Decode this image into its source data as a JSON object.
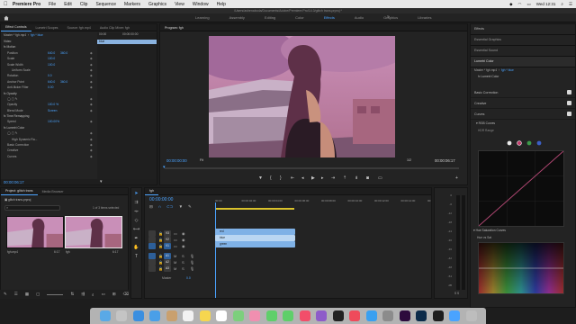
{
  "menubar": {
    "app": "Premiere Pro",
    "items": [
      "File",
      "Edit",
      "Clip",
      "Sequence",
      "Markers",
      "Graphics",
      "View",
      "Window",
      "Help"
    ],
    "clock": "Wed 12:31"
  },
  "window": {
    "title": "/Users/ashenaboda/Documents/Adobe/Premiere Pro/14.0/glitch trans.prproj *"
  },
  "workspaces": {
    "tabs": [
      "Learning",
      "Assembly",
      "Editing",
      "Color",
      "Effects",
      "Audio",
      "Graphics",
      "Libraries"
    ],
    "active": "Effects",
    "more": "»"
  },
  "source_panel": {
    "tabs": [
      "Effect Controls",
      "Lumetri Scopes",
      "Source: fgh.mp4",
      "Audio Clip Mixer: fgh"
    ],
    "master": "Master * fgh.mp4",
    "clip": "fgh * blue",
    "tc_start": "00:00",
    "tc_end": "00:00:00:00",
    "clip_label": "blue",
    "rows": [
      {
        "label": "Video",
        "indent": 0,
        "hdr": true
      },
      {
        "label": "fx  Motion",
        "indent": 0,
        "hdr": true
      },
      {
        "label": "Position",
        "indent": 1,
        "v": "640.0",
        "v2": "360.0"
      },
      {
        "label": "Scale",
        "indent": 1,
        "v": "100.0"
      },
      {
        "label": "Scale Width",
        "indent": 1,
        "v": "100.0"
      },
      {
        "label": "Uniform Scale",
        "indent": 2,
        "v": ""
      },
      {
        "label": "Rotation",
        "indent": 1,
        "v": "0.0"
      },
      {
        "label": "Anchor Point",
        "indent": 1,
        "v": "640.0",
        "v2": "360.0"
      },
      {
        "label": "Anti-flicker Filter",
        "indent": 1,
        "v": "0.00"
      },
      {
        "label": "fx  Opacity",
        "indent": 0,
        "hdr": true
      },
      {
        "label": "◯ ▢ ✎",
        "indent": 1,
        "v": ""
      },
      {
        "label": "Opacity",
        "indent": 1,
        "v": "100.0 %"
      },
      {
        "label": "Blend Mode",
        "indent": 1,
        "v": "Screen"
      },
      {
        "label": "fx  Time Remapping",
        "indent": 0,
        "hdr": true
      },
      {
        "label": "Speed",
        "indent": 1,
        "v": "100.00%"
      },
      {
        "label": "fx  Lumetri Color",
        "indent": 0,
        "hdr": true
      },
      {
        "label": "◯ ▢ ✎",
        "indent": 1,
        "v": ""
      },
      {
        "label": "High Dynamic Ra...",
        "indent": 2,
        "v": ""
      },
      {
        "label": "Basic Correction",
        "indent": 1,
        "v": ""
      },
      {
        "label": "Creative",
        "indent": 1,
        "v": ""
      },
      {
        "label": "Curves",
        "indent": 1,
        "v": ""
      }
    ],
    "bottom_tc": "00:00:06:17"
  },
  "program": {
    "tab": "Program: fgh",
    "tc_current": "00:00:00:00",
    "fit": "Fit",
    "quality": "1/2",
    "tc_duration": "00:00:06:17"
  },
  "effects_panel": {
    "tabs": [
      "Effects",
      "Essential Graphics",
      "Essential Sound",
      "Lumetri Color",
      "Libraries",
      "Markers",
      "History",
      "Info"
    ],
    "master": "Master * fgh.mp4",
    "clip": "fgh * blue",
    "fx_name": "Lumetri Color",
    "sections": [
      "Basic Correction",
      "Creative",
      "Curves"
    ],
    "rgb_curves": "RGB Curves",
    "hsl_range": "HDR Range",
    "hsl_curves": "Hue Saturation Curves",
    "hue_vs_sat": "Hue vs Sat"
  },
  "project": {
    "tabs": [
      "Project: glitch trans",
      "Media Browser"
    ],
    "file": "glitch trans.prproj",
    "selection": "1 of 3 items selected",
    "items": [
      {
        "name": "fgh.mp4",
        "dur": "6:17"
      },
      {
        "name": "fgh",
        "dur": "6:17"
      }
    ]
  },
  "timeline": {
    "tab": "fgh",
    "tc": "00:00:00:00",
    "ruler": [
      "00:00",
      "00:00:02:00",
      "00:00:04:00",
      "00:00:06:00",
      "00:00:08:00",
      "00:00:10:00",
      "00:00:12:00",
      "00:00:14:00",
      "00:00:16:00"
    ],
    "tracks": [
      "V3",
      "V2",
      "V1",
      "A1",
      "A2",
      "A3"
    ],
    "master": "Master",
    "master_val": "0.0",
    "clips": [
      {
        "name": "red",
        "color": "#7fb1e6"
      },
      {
        "name": "blue",
        "color": "#bad6f2"
      },
      {
        "name": "green",
        "color": "#7fb1e6"
      }
    ]
  },
  "audio_meter": {
    "labels": [
      "0",
      "-6",
      "-12",
      "-18",
      "-24",
      "-30",
      "-36",
      "-42",
      "-48",
      "-54",
      "dB"
    ],
    "solo": "S S"
  },
  "dock": {
    "apps": [
      "Finder",
      "Launchpad",
      "Safari",
      "Mail",
      "Contacts",
      "Calendar",
      "Notes",
      "Reminders",
      "Maps",
      "Photos",
      "Messages",
      "FaceTime",
      "Music",
      "Podcasts",
      "TV",
      "News",
      "App Store",
      "System Preferences",
      "Pr",
      "Ps",
      "Media Encoder",
      "Downloads",
      "Trash"
    ]
  }
}
